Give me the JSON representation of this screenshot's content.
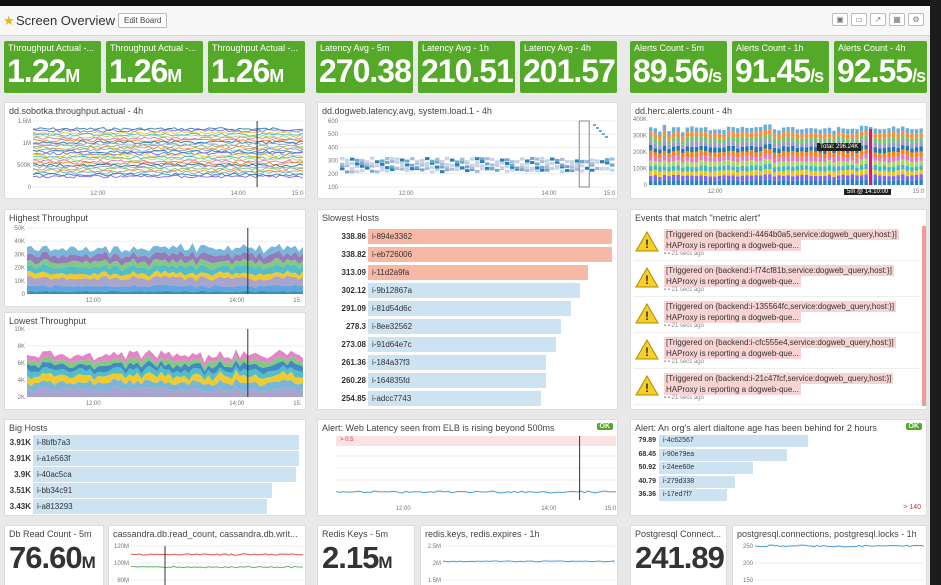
{
  "header": {
    "title": "Screen Overview",
    "edit_label": "Edit Board",
    "icons": [
      "camera-icon",
      "tv-icon",
      "share-icon",
      "layout-icon",
      "gear-icon"
    ]
  },
  "colors": {
    "green": "#55a928",
    "red_bar": "#f8b8a6",
    "blue_bar": "#cde3f2",
    "event_bg": "#f7d3d3"
  },
  "tiles": [
    {
      "label": "Throughput Actual -...",
      "value": "1.22",
      "unit": "M"
    },
    {
      "label": "Throughput Actual -...",
      "value": "1.26",
      "unit": "M"
    },
    {
      "label": "Throughput Actual -...",
      "value": "1.26",
      "unit": "M"
    },
    {
      "label": "Latency Avg - 5m",
      "value": "270.38",
      "unit": ""
    },
    {
      "label": "Latency Avg - 1h",
      "value": "210.51",
      "unit": ""
    },
    {
      "label": "Latency Avg - 4h",
      "value": "201.57",
      "unit": ""
    },
    {
      "label": "Alerts Count - 5m",
      "value": "89.56",
      "unit": "/s"
    },
    {
      "label": "Alerts Count - 1h",
      "value": "91.45",
      "unit": "/s"
    },
    {
      "label": "Alerts Count - 4h",
      "value": "92.55",
      "unit": "/s"
    }
  ],
  "p1": {
    "title": "dd.sobotka.throughput.actual - 4h",
    "yticks": [
      "1.5M",
      "1M",
      "500K",
      "0"
    ],
    "xticks": [
      "12:00",
      "14:00",
      "15:0"
    ]
  },
  "p2": {
    "title": "dd.dogweb.latency.avg, system.load.1 - 4h",
    "yticks": [
      "600",
      "500",
      "400",
      "300",
      "200",
      "100"
    ],
    "xticks": [
      "12:00",
      "14:00",
      "15:0"
    ]
  },
  "p3": {
    "title": "dd.herc.alerts.count - 4h",
    "yticks": [
      "400K",
      "300K",
      "200K",
      "100K",
      "0"
    ],
    "xticks": [
      "12:00",
      "14:00",
      "15:0"
    ],
    "tooltip": "Total: 296.24K",
    "cursor": "5m @ 14:10:00"
  },
  "p4": {
    "title": "Highest Throughput",
    "yticks": [
      "50K",
      "40K",
      "30K",
      "20K",
      "10K",
      "0"
    ],
    "xticks": [
      "12:00",
      "14:00",
      "15:"
    ]
  },
  "p5": {
    "title": "Lowest Throughput",
    "yticks": [
      "10K",
      "8K",
      "6K",
      "4K",
      "2K"
    ],
    "xticks": [
      "12:00",
      "14:00",
      "15:"
    ]
  },
  "slowest": {
    "title": "Slowest Hosts",
    "rows": [
      {
        "value": "338.86",
        "host": "i-894e3362",
        "hot": true,
        "frac": 1.0
      },
      {
        "value": "338.82",
        "host": "i-eb726006",
        "hot": true,
        "frac": 1.0
      },
      {
        "value": "313.09",
        "host": "i-11d2a9fa",
        "hot": true,
        "frac": 0.9
      },
      {
        "value": "302.12",
        "host": "i-9b12867a",
        "hot": false,
        "frac": 0.87
      },
      {
        "value": "291.09",
        "host": "i-81d54d6c",
        "hot": false,
        "frac": 0.83
      },
      {
        "value": "278.3",
        "host": "i-8ee32562",
        "hot": false,
        "frac": 0.79
      },
      {
        "value": "273.08",
        "host": "i-91d64e7c",
        "hot": false,
        "frac": 0.77
      },
      {
        "value": "261.36",
        "host": "i-184a37f3",
        "hot": false,
        "frac": 0.73
      },
      {
        "value": "260.28",
        "host": "i-164835fd",
        "hot": false,
        "frac": 0.73
      },
      {
        "value": "254.85",
        "host": "i-adcc7743",
        "hot": false,
        "frac": 0.71
      }
    ]
  },
  "events": {
    "title": "Events that match \"metric alert\"",
    "items": [
      {
        "line1": "[Triggered on {backend:i-4464b0a5,service:dogweb_query,host:}]",
        "line2": "HAProxy is reporting a dogweb-que...",
        "ago": "21 secs ago"
      },
      {
        "line1": "[Triggered on {backend:i-f74cf81b,service:dogweb_query,host:}]",
        "line2": "HAProxy is reporting a dogweb-que...",
        "ago": "21 secs ago"
      },
      {
        "line1": "[Triggered on {backend:i-135564fc,service:dogweb_query,host:}]",
        "line2": "HAProxy is reporting a dogweb-que...",
        "ago": "21 secs ago"
      },
      {
        "line1": "[Triggered on {backend:i-cfc555e4,service:dogweb_query,host:}]",
        "line2": "HAProxy is reporting a dogweb-que...",
        "ago": "21 secs ago"
      },
      {
        "line1": "[Triggered on {backend:i-21c47fcf,service:dogweb_query,host:}]",
        "line2": "HAProxy is reporting a dogweb-que...",
        "ago": "21 secs ago"
      }
    ]
  },
  "bighosts": {
    "title": "Big Hosts",
    "rows": [
      {
        "value": "3.91K",
        "host": "i-8bfb7a3",
        "frac": 1.0
      },
      {
        "value": "3.91K",
        "host": "i-a1e563f",
        "frac": 1.0
      },
      {
        "value": "3.9K",
        "host": "i-40ac5ca",
        "frac": 0.99
      },
      {
        "value": "3.51K",
        "host": "i-bb34c91",
        "frac": 0.9
      },
      {
        "value": "3.43K",
        "host": "i-a813293",
        "frac": 0.88
      }
    ]
  },
  "alert_latency": {
    "title": "Alert: Web Latency seen from ELB is rising beyond 500ms",
    "status": "OK",
    "threshold": "> 0.5",
    "xticks": [
      "12:00",
      "14:00",
      "15:0"
    ]
  },
  "alert_dialtone": {
    "title": "Alert: An org's alert dialtone age has been behind for 2 hours",
    "status": "OK",
    "threshold": "> 140",
    "rows": [
      {
        "value": "79.89",
        "host": "i-4c62567",
        "frac": 0.57
      },
      {
        "value": "68.45",
        "host": "i-90e79ea",
        "frac": 0.49
      },
      {
        "value": "50.92",
        "host": "i-24ee60e",
        "frac": 0.36
      },
      {
        "value": "40.79",
        "host": "i-279d338",
        "frac": 0.29
      },
      {
        "value": "36.36",
        "host": "i-17ed7f7",
        "frac": 0.26
      }
    ]
  },
  "dbread": {
    "title": "Db Read Count - 5m",
    "value": "76.60",
    "unit": "M"
  },
  "cassandra": {
    "title": "cassandra.db.read_count, cassandra.db.writ...",
    "yticks": [
      "120M",
      "100M",
      "80M"
    ]
  },
  "redis": {
    "title": "Redis Keys - 5m",
    "value": "2.15",
    "unit": "M"
  },
  "redisgraph": {
    "title": "redis.keys, redis.expires - 1h",
    "yticks": [
      "2.5M",
      "2M",
      "1.5M"
    ]
  },
  "pg": {
    "title": "Postgresql Connect...",
    "value": "241.89",
    "unit": ""
  },
  "pggraph": {
    "title": "postgresql.connections, postgresql.locks - 1h",
    "yticks": [
      "250",
      "200",
      "150"
    ]
  }
}
